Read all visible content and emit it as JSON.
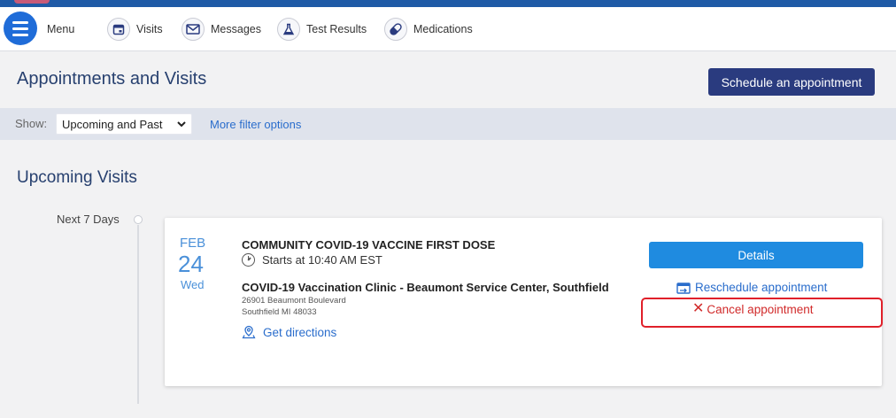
{
  "nav": {
    "menu_label": "Menu",
    "items": [
      {
        "label": "Visits",
        "icon": "calendar-icon"
      },
      {
        "label": "Messages",
        "icon": "envelope-icon"
      },
      {
        "label": "Test Results",
        "icon": "flask-icon"
      },
      {
        "label": "Medications",
        "icon": "pill-icon"
      }
    ]
  },
  "header": {
    "title": "Appointments and Visits",
    "schedule_button": "Schedule an appointment"
  },
  "filter": {
    "show_label": "Show:",
    "selected": "Upcoming and Past",
    "more_options": "More filter options"
  },
  "upcoming": {
    "title": "Upcoming Visits",
    "timeline_label": "Next 7 Days"
  },
  "appointment": {
    "month": "FEB",
    "day": "24",
    "weekday": "Wed",
    "visit_type": "COMMUNITY COVID-19 VACCINE FIRST DOSE",
    "time": "Starts at 10:40 AM EST",
    "clinic": "COVID-19 Vaccination Clinic - Beaumont Service Center, Southfield",
    "address_line1": "26901 Beaumont Boulevard",
    "address_line2": "Southfield MI 48033",
    "directions": "Get directions",
    "details_button": "Details",
    "reschedule": "Reschedule appointment",
    "cancel": "Cancel appointment"
  },
  "colors": {
    "brand_dark": "#2a3b7f",
    "accent_blue": "#1f8be0",
    "link_blue": "#2a6dcc",
    "date_blue": "#4a90d9",
    "cancel_red": "#d12a2a",
    "highlight_red": "#e0202a"
  }
}
